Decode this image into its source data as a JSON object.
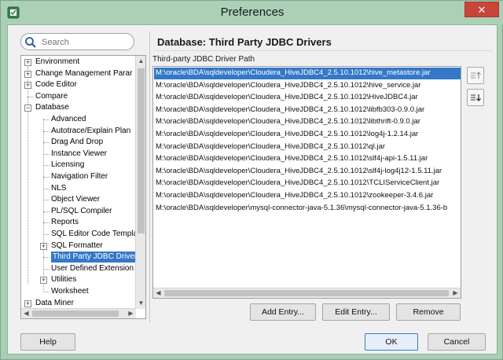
{
  "window": {
    "title": "Preferences",
    "close_glyph": "✕"
  },
  "search": {
    "placeholder": "Search"
  },
  "tree": {
    "items": [
      {
        "label": "Environment",
        "expander": "+"
      },
      {
        "label": "Change Management Parar",
        "expander": "+"
      },
      {
        "label": "Code Editor",
        "expander": "+"
      },
      {
        "label": "Compare",
        "expander": ""
      },
      {
        "label": "Database",
        "expander": "−"
      },
      {
        "label": "Advanced",
        "expander": ""
      },
      {
        "label": "Autotrace/Explain Plan",
        "expander": ""
      },
      {
        "label": "Drag And Drop",
        "expander": ""
      },
      {
        "label": "Instance Viewer",
        "expander": ""
      },
      {
        "label": "Licensing",
        "expander": ""
      },
      {
        "label": "Navigation Filter",
        "expander": ""
      },
      {
        "label": "NLS",
        "expander": ""
      },
      {
        "label": "Object Viewer",
        "expander": ""
      },
      {
        "label": "PL/SQL Compiler",
        "expander": ""
      },
      {
        "label": "Reports",
        "expander": ""
      },
      {
        "label": "SQL Editor Code Templa",
        "expander": ""
      },
      {
        "label": "SQL Formatter",
        "expander": "+"
      },
      {
        "label": "Third Party JDBC Driver",
        "expander": ""
      },
      {
        "label": "User Defined Extension",
        "expander": ""
      },
      {
        "label": "Utilities",
        "expander": "+"
      },
      {
        "label": "Worksheet",
        "expander": ""
      },
      {
        "label": "Data Miner",
        "expander": "+"
      }
    ]
  },
  "main": {
    "title": "Database: Third Party JDBC Drivers",
    "path_label": "Third-party JDBC Driver Path",
    "paths": [
      "M:\\oracle\\BDA\\sqldeveloper\\Cloudera_HiveJDBC4_2.5.10.1012\\hive_metastore.jar",
      "M:\\oracle\\BDA\\sqldeveloper\\Cloudera_HiveJDBC4_2.5.10.1012\\hive_service.jar",
      "M:\\oracle\\BDA\\sqldeveloper\\Cloudera_HiveJDBC4_2.5.10.1012\\HiveJDBC4.jar",
      "M:\\oracle\\BDA\\sqldeveloper\\Cloudera_HiveJDBC4_2.5.10.1012\\libfb303-0.9.0.jar",
      "M:\\oracle\\BDA\\sqldeveloper\\Cloudera_HiveJDBC4_2.5.10.1012\\libthrift-0.9.0.jar",
      "M:\\oracle\\BDA\\sqldeveloper\\Cloudera_HiveJDBC4_2.5.10.1012\\log4j-1.2.14.jar",
      "M:\\oracle\\BDA\\sqldeveloper\\Cloudera_HiveJDBC4_2.5.10.1012\\ql.jar",
      "M:\\oracle\\BDA\\sqldeveloper\\Cloudera_HiveJDBC4_2.5.10.1012\\slf4j-api-1.5.11.jar",
      "M:\\oracle\\BDA\\sqldeveloper\\Cloudera_HiveJDBC4_2.5.10.1012\\slf4j-log4j12-1.5.11.jar",
      "M:\\oracle\\BDA\\sqldeveloper\\Cloudera_HiveJDBC4_2.5.10.1012\\TCLIServiceClient.jar",
      "M:\\oracle\\BDA\\sqldeveloper\\Cloudera_HiveJDBC4_2.5.10.1012\\zookeeper-3.4.6.jar",
      "M:\\oracle\\BDA\\sqldeveloper\\mysql-connector-java-5.1.36\\mysql-connector-java-5.1.36-b"
    ],
    "add_entry": "Add Entry...",
    "edit_entry": "Edit Entry...",
    "remove": "Remove"
  },
  "footer": {
    "help": "Help",
    "ok": "OK",
    "cancel": "Cancel"
  },
  "colors": {
    "selection": "#3478c8",
    "titlebar": "#abd0b6",
    "close": "#c9453a"
  }
}
